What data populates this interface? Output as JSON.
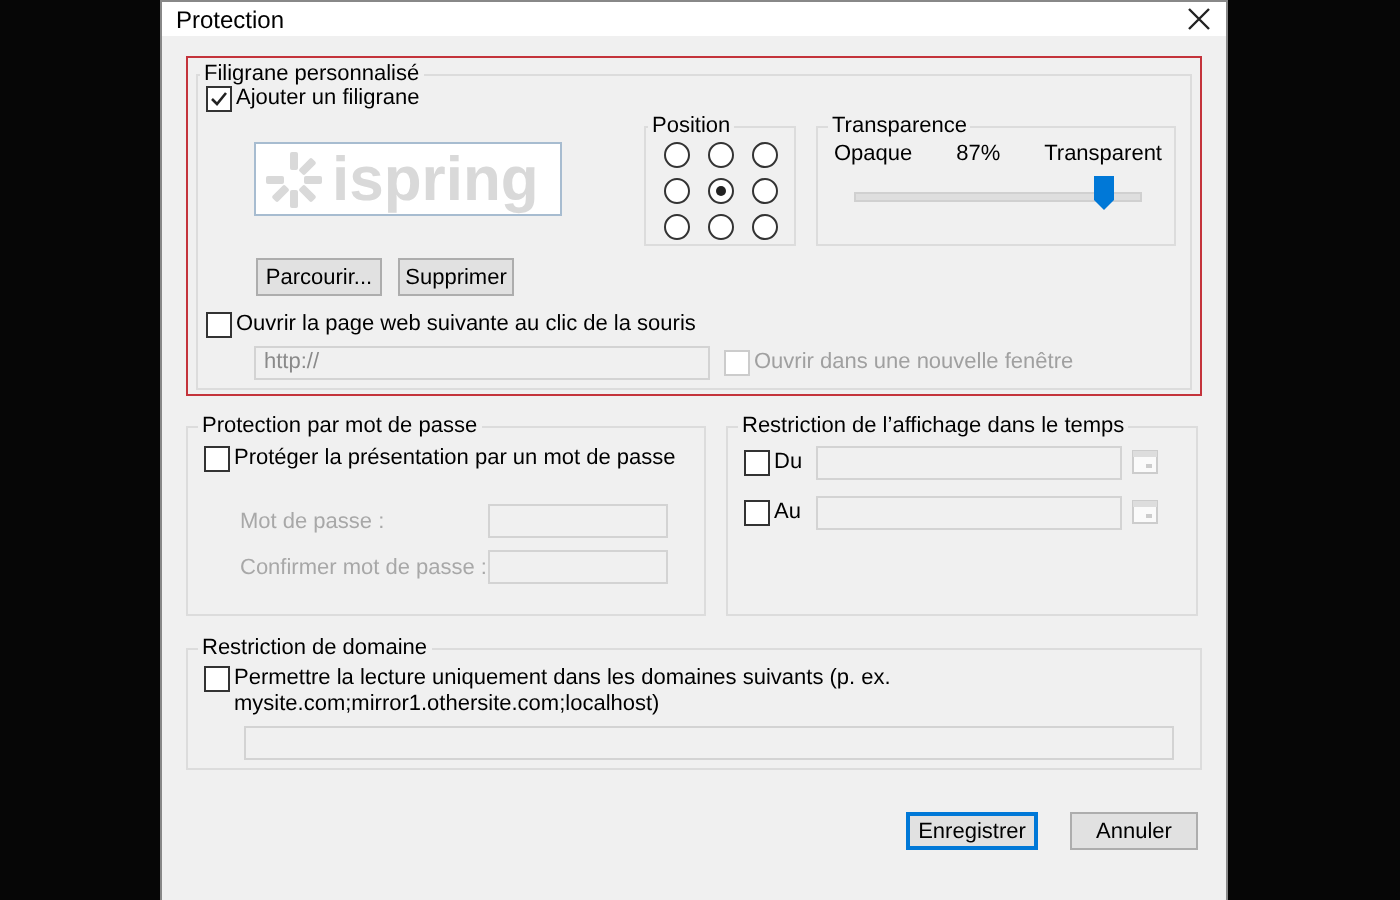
{
  "window": {
    "title": "Protection"
  },
  "watermark": {
    "title": "Filigrane personnalisé",
    "highlighted": true,
    "add_checkbox": {
      "label": "Ajouter un filigrane",
      "checked": true
    },
    "preview_text": "ispring",
    "position": {
      "title": "Position",
      "cells": [
        {
          "selected": false
        },
        {
          "selected": false
        },
        {
          "selected": false
        },
        {
          "selected": false
        },
        {
          "selected": true
        },
        {
          "selected": false
        },
        {
          "selected": false
        },
        {
          "selected": false
        },
        {
          "selected": false
        }
      ]
    },
    "transparency": {
      "title": "Transparence",
      "min_label": "Opaque",
      "reading": "87%",
      "max_label": "Transparent",
      "level": 0.87
    },
    "buttons": [
      "Parcourir...",
      "Supprimer"
    ],
    "link_checkbox": {
      "label": "Ouvrir la page web suivante au clic de la souris",
      "checked": false
    },
    "url_field": {
      "placeholder": "http://",
      "disabled": true
    },
    "new_window_checkbox": {
      "label": "Ouvrir dans une nouvelle fenêtre",
      "checked": false,
      "disabled": true
    }
  },
  "password": {
    "title": "Protection par mot de passe",
    "checkbox": {
      "label": "Protéger la présentation par un mot de passe",
      "checked": false
    },
    "fields": [
      {
        "label": "Mot de passe :",
        "disabled": true
      },
      {
        "label": "Confirmer mot de passe :",
        "disabled": true
      }
    ]
  },
  "time": {
    "title": "Restriction de l’affichage dans le temps",
    "rows": [
      {
        "label": "Du",
        "checked": false
      },
      {
        "label": "Au",
        "checked": false
      }
    ]
  },
  "domain": {
    "title": "Restriction de domaine",
    "checkbox": {
      "label": "Permettre la lecture uniquement dans les domaines suivants (p. ex. mysite.com;mirror1.othersite.com;localhost)",
      "checked": false
    }
  },
  "buttons": [
    {
      "label": "Enregistrer",
      "default": true
    },
    {
      "label": "Annuler",
      "default": false
    }
  ]
}
